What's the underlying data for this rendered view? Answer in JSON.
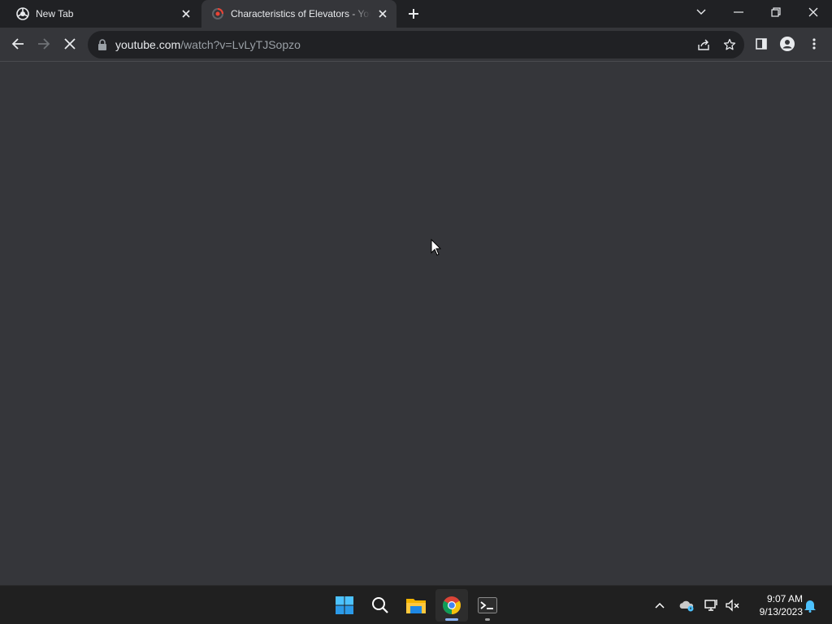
{
  "tabs": [
    {
      "title": "New Tab",
      "icon": "chrome-icon"
    },
    {
      "title": "Characteristics of Elevators - YouTube",
      "icon": "loading-spinner-icon"
    }
  ],
  "toolbar": {
    "url_host": "youtube.com",
    "url_path": "/watch?v=LvLyTJSopzo",
    "reload_state": "stop-loading"
  },
  "taskbar": {
    "apps": [
      "windows-start",
      "search",
      "file-explorer",
      "chrome",
      "terminal"
    ],
    "time": "9:07 AM",
    "date": "9/13/2023"
  },
  "colors": {
    "chrome_bg": "#202124",
    "toolbar_bg": "#35363a",
    "content_bg": "#35363a",
    "accent_blue": "#8ab4f8",
    "taskbar_bg": "#202020"
  }
}
